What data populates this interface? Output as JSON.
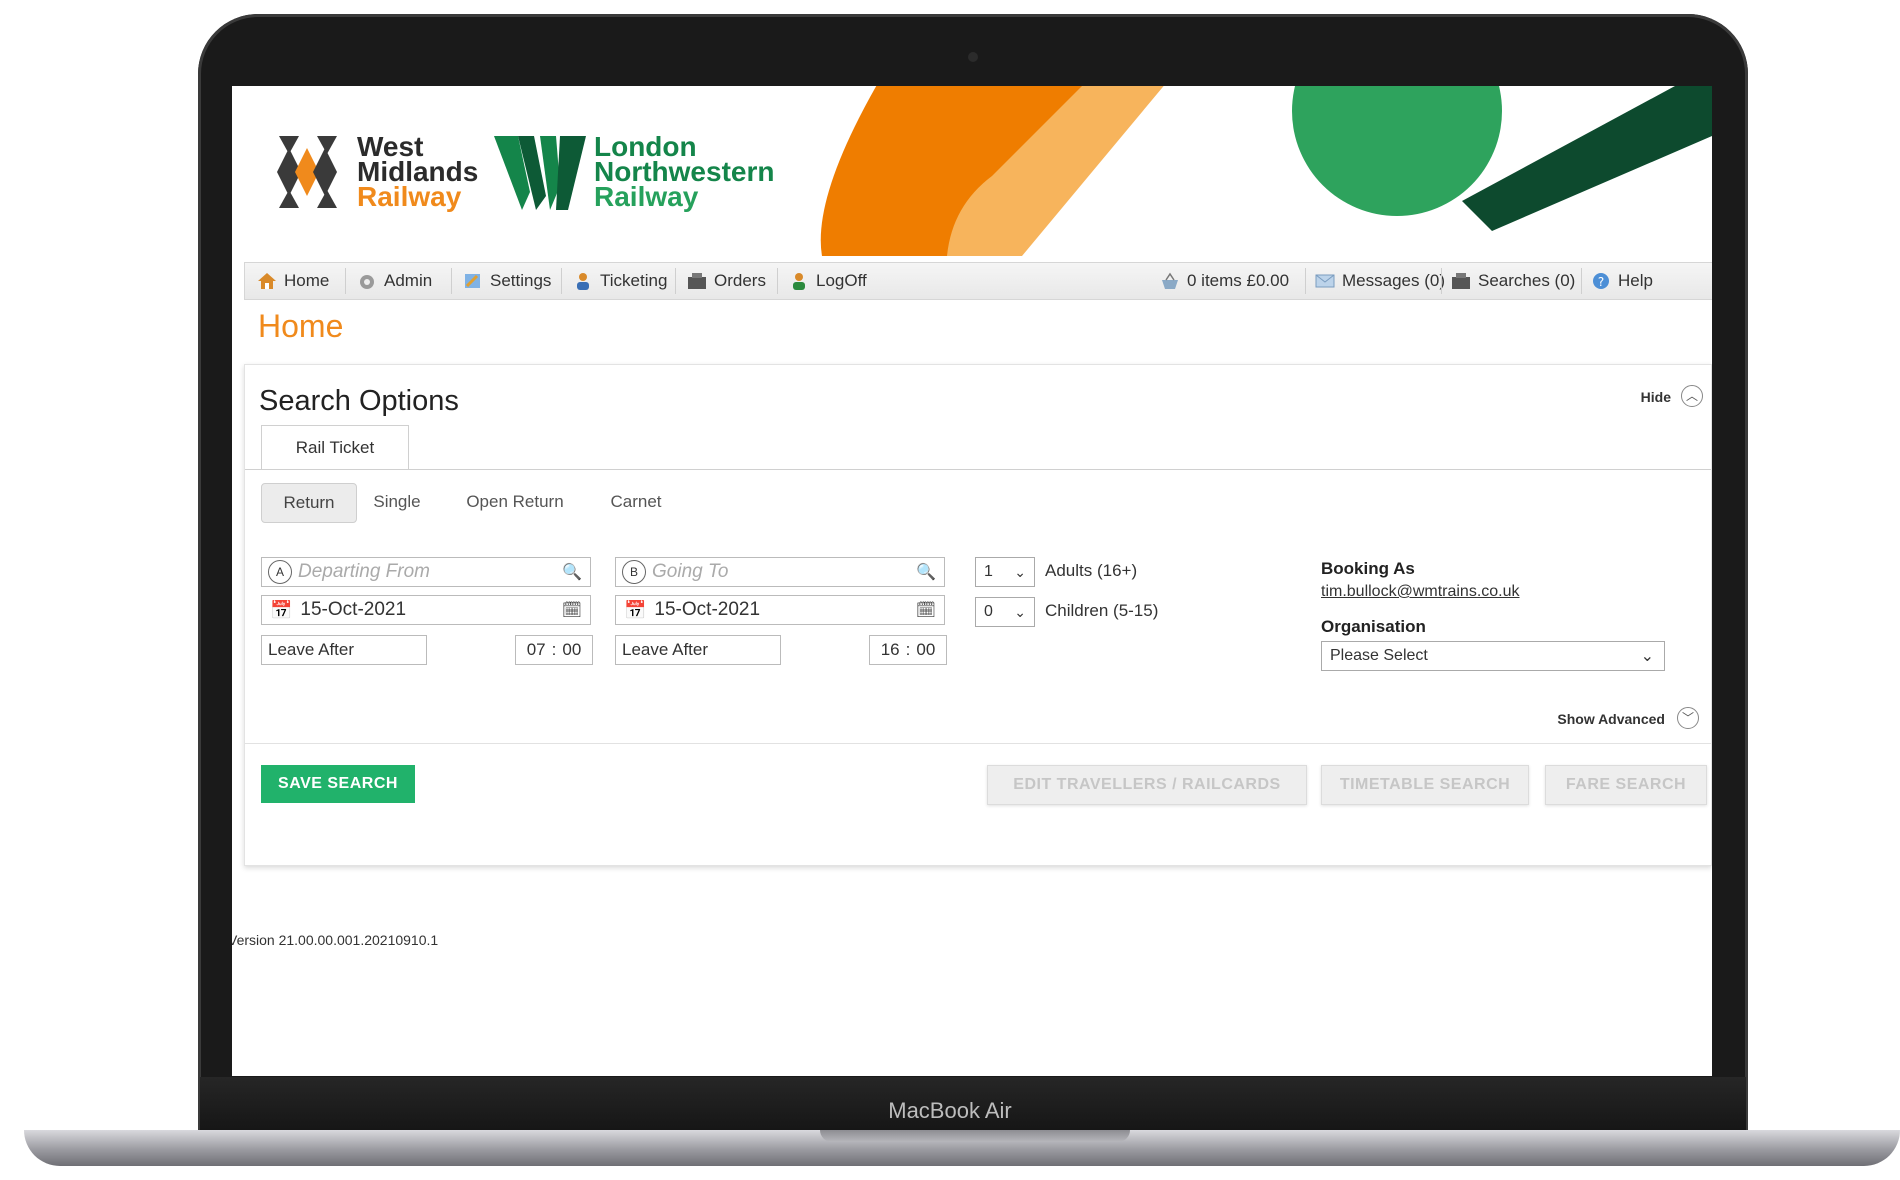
{
  "device": {
    "brand": "MacBook Air"
  },
  "header": {
    "logo1": {
      "line1": "West",
      "line2": "Midlands",
      "line3": "Railway"
    },
    "logo2": {
      "line1": "London",
      "line2": "Northwestern",
      "line3": "Railway"
    }
  },
  "nav": {
    "left": [
      {
        "label": "Home",
        "icon": "home-icon"
      },
      {
        "label": "Admin",
        "icon": "gear-icon"
      },
      {
        "label": "Settings",
        "icon": "settings-icon"
      },
      {
        "label": "Ticketing",
        "icon": "person-icon"
      },
      {
        "label": "Orders",
        "icon": "orders-icon"
      },
      {
        "label": "LogOff",
        "icon": "logoff-icon"
      }
    ],
    "right": [
      {
        "label": "0 items £0.00",
        "icon": "basket-icon"
      },
      {
        "label": "Messages (0)",
        "icon": "mail-icon"
      },
      {
        "label": "Searches (0)",
        "icon": "searches-icon"
      },
      {
        "label": "Help",
        "icon": "help-icon"
      }
    ]
  },
  "page_title": "Home",
  "search": {
    "title": "Search Options",
    "hide_label": "Hide",
    "tab": "Rail Ticket",
    "journey_types": [
      "Return",
      "Single",
      "Open Return",
      "Carnet"
    ],
    "outbound": {
      "from_placeholder": "Departing From",
      "date": "15-Oct-2021",
      "time_mode": "Leave After",
      "hour": "07",
      "minute": "00"
    },
    "inbound": {
      "to_placeholder": "Going To",
      "date": "15-Oct-2021",
      "time_mode": "Leave After",
      "hour": "16",
      "minute": "00"
    },
    "passengers": {
      "adults_value": "1",
      "adults_label": "Adults (16+)",
      "children_value": "0",
      "children_label": "Children (5-15)"
    },
    "booking_as_label": "Booking As",
    "booking_as_email": "tim.bullock@wmtrains.co.uk",
    "organisation_label": "Organisation",
    "organisation_value": "Please Select",
    "show_advanced": "Show Advanced",
    "buttons": {
      "save": "SAVE SEARCH",
      "edit": "EDIT TRAVELLERS / RAILCARDS",
      "timetable": "TIMETABLE SEARCH",
      "fare": "FARE SEARCH"
    }
  },
  "version": "Version 21.00.00.001.20210910.1",
  "colors": {
    "accent": "#f08a1c",
    "brand_green": "#14854a",
    "save_button": "#21b26b"
  }
}
